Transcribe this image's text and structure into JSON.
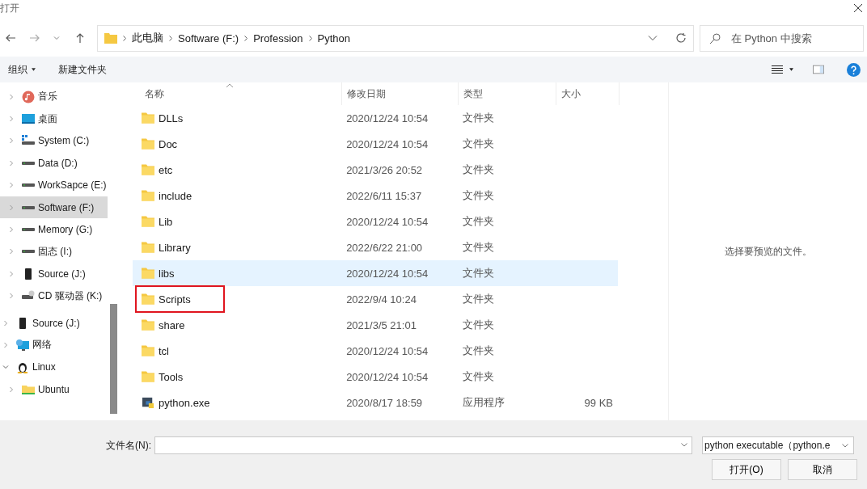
{
  "window": {
    "title": "打开"
  },
  "address": {
    "path": [
      {
        "label": "此电脑"
      },
      {
        "label": "Software (F:)"
      },
      {
        "label": "Profession"
      },
      {
        "label": "Python"
      }
    ]
  },
  "search": {
    "placeholder": "在 Python 中搜索"
  },
  "toolbar": {
    "organize": "组织",
    "new_folder": "新建文件夹"
  },
  "sidebar": {
    "scrolled_items": [
      {
        "label": "音乐",
        "kind": "music",
        "selected": false
      },
      {
        "label": "桌面",
        "kind": "desktop",
        "selected": false
      },
      {
        "label": "System (C:)",
        "kind": "system-drive",
        "selected": false
      },
      {
        "label": "Data (D:)",
        "kind": "drive",
        "selected": false
      },
      {
        "label": "WorkSapce (E:)",
        "kind": "drive",
        "selected": false
      },
      {
        "label": "Software (F:)",
        "kind": "drive",
        "selected": true
      },
      {
        "label": "Memory (G:)",
        "kind": "drive",
        "selected": false
      },
      {
        "label": "固态 (I:)",
        "kind": "drive",
        "selected": false
      },
      {
        "label": "Source (J:)",
        "kind": "device",
        "selected": false
      },
      {
        "label": "CD 驱动器 (K:)",
        "kind": "cd",
        "selected": false
      }
    ],
    "items": [
      {
        "label": "Source (J:)",
        "kind": "device",
        "selected": false,
        "expanded": false
      },
      {
        "label": "网络",
        "kind": "network",
        "selected": false,
        "expanded": false
      },
      {
        "label": "Linux",
        "kind": "linux",
        "selected": false,
        "expanded": true,
        "children": [
          {
            "label": "Ubuntu",
            "kind": "folder",
            "selected": false,
            "expanded": false
          }
        ]
      }
    ]
  },
  "table": {
    "columns": [
      {
        "label": "名称",
        "sorted": true
      },
      {
        "label": "修改日期",
        "sorted": false
      },
      {
        "label": "类型",
        "sorted": false
      },
      {
        "label": "大小",
        "sorted": false
      }
    ],
    "rows": [
      {
        "name": "DLLs",
        "date": "2020/12/24 10:54",
        "type": "文件夹",
        "kind": "folder",
        "hovered": false,
        "annotated": false
      },
      {
        "name": "Doc",
        "date": "2020/12/24 10:54",
        "type": "文件夹",
        "kind": "folder",
        "hovered": false,
        "annotated": false
      },
      {
        "name": "etc",
        "date": "2021/3/26 20:52",
        "type": "文件夹",
        "kind": "folder",
        "hovered": false,
        "annotated": false
      },
      {
        "name": "include",
        "date": "2022/6/11 15:37",
        "type": "文件夹",
        "kind": "folder",
        "hovered": false,
        "annotated": false
      },
      {
        "name": "Lib",
        "date": "2020/12/24 10:54",
        "type": "文件夹",
        "kind": "folder",
        "hovered": false,
        "annotated": false
      },
      {
        "name": "Library",
        "date": "2022/6/22 21:00",
        "type": "文件夹",
        "kind": "folder",
        "hovered": false,
        "annotated": false
      },
      {
        "name": "libs",
        "date": "2020/12/24 10:54",
        "type": "文件夹",
        "kind": "folder",
        "hovered": true,
        "annotated": false
      },
      {
        "name": "Scripts",
        "date": "2022/9/4 10:24",
        "type": "文件夹",
        "kind": "folder",
        "hovered": false,
        "annotated": true
      },
      {
        "name": "share",
        "date": "2021/3/5 21:01",
        "type": "文件夹",
        "kind": "folder",
        "hovered": false,
        "annotated": false
      },
      {
        "name": "tcl",
        "date": "2020/12/24 10:54",
        "type": "文件夹",
        "kind": "folder",
        "hovered": false,
        "annotated": false
      },
      {
        "name": "Tools",
        "date": "2020/12/24 10:54",
        "type": "文件夹",
        "kind": "folder",
        "hovered": false,
        "annotated": false
      },
      {
        "name": "python.exe",
        "date": "2020/8/17 18:59",
        "type": "应用程序",
        "size": "99 KB",
        "kind": "exe",
        "hovered": false,
        "annotated": false
      }
    ]
  },
  "preview": {
    "message": "选择要预览的文件。"
  },
  "footer": {
    "filename_label": "文件名(N):",
    "file_type": "python executable（python.e",
    "open_button": "打开(O)",
    "cancel_button": "取消"
  }
}
